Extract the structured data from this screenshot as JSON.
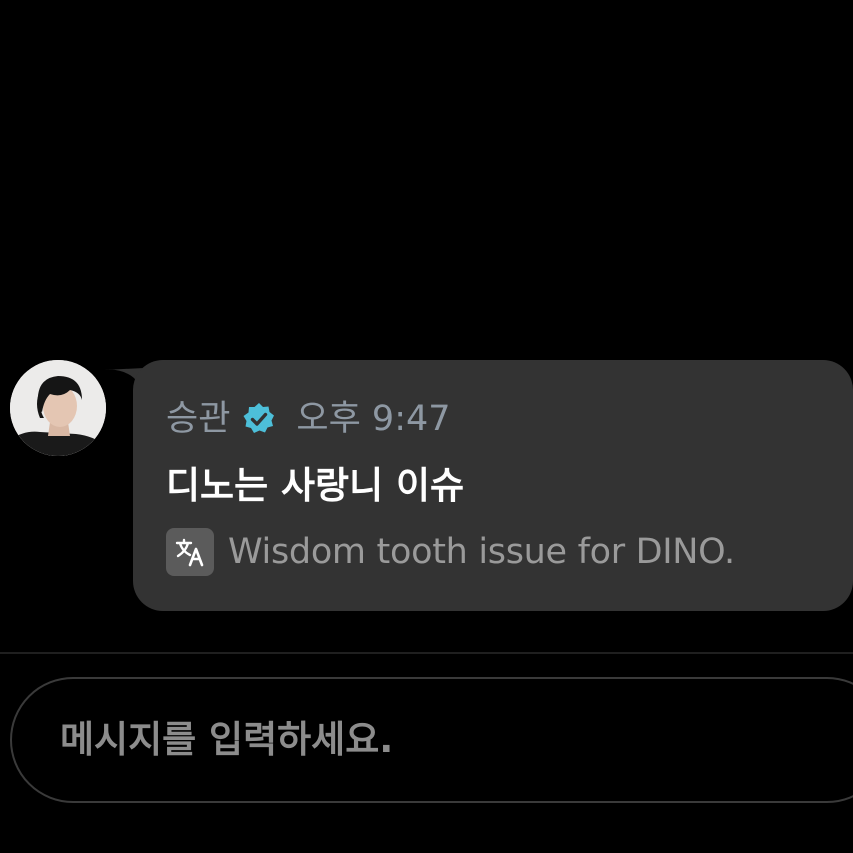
{
  "message": {
    "sender_name": "승관",
    "verified_icon": "verified-badge-icon",
    "time": "오후 9:47",
    "text": "디노는 사랑니 이슈",
    "translate_icon": "translate-icon",
    "translation": "Wisdom tooth issue for DINO."
  },
  "composer": {
    "placeholder": "메시지를 입력하세요."
  },
  "colors": {
    "background": "#000000",
    "bubble": "#333333",
    "verified_badge": "#4dbfd9",
    "meta_text": "#8e98a3",
    "message_text": "#ffffff",
    "translation_text": "#9a9a9a"
  }
}
